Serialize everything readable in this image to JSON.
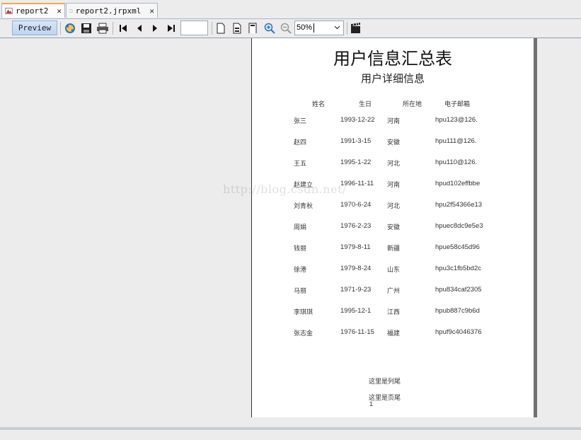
{
  "tabs": [
    {
      "label": "report2",
      "icon": "report-icon",
      "active": true
    },
    {
      "label": "report2.jrpxml",
      "icon": "document-icon",
      "active": false
    }
  ],
  "toolbar": {
    "preview_label": "Preview",
    "page_input_value": "",
    "zoom_value": "50%"
  },
  "report": {
    "title": "用户信息汇总表",
    "subtitle": "用户详细信息",
    "columns": [
      "姓名",
      "生日",
      "所在地",
      "电子邮箱"
    ],
    "rows": [
      [
        "张三",
        "1993-12-22",
        "河南",
        "hpu123@126."
      ],
      [
        "赵四",
        "1991-3-15",
        "安徽",
        "hpu111@126."
      ],
      [
        "王五",
        "1995-1-22",
        "河北",
        "hpu110@126."
      ],
      [
        "赵建立",
        "1996-11-11",
        "河南",
        "hpud102effbbe"
      ],
      [
        "刘青秋",
        "1970-6-24",
        "河北",
        "hpu2f54366e13"
      ],
      [
        "周娟",
        "1976-2-23",
        "安徽",
        "hpuec8dc9e5e3"
      ],
      [
        "钱丽",
        "1979-8-11",
        "新疆",
        "hpue58c45d96"
      ],
      [
        "徐港",
        "1979-8-24",
        "山东",
        "hpu3c1fb5bd2c"
      ],
      [
        "马丽",
        "1971-9-23",
        "广州",
        "hpu834caf2305"
      ],
      [
        "李琪琪",
        "1995-12-1",
        "江西",
        "hpub887c9b6d"
      ],
      [
        "张志金",
        "1976-11-15",
        "福建",
        "hpuf9c4046376"
      ]
    ],
    "column_footer": "这里是列尾",
    "page_footer": "这里是页尾",
    "page_number": "1"
  },
  "watermark": "http://blog.csdn.net/",
  "colors": {
    "active_tab_accent": "#f2a94b",
    "preview_button": "#c8ddf3",
    "background": "#ececec"
  }
}
